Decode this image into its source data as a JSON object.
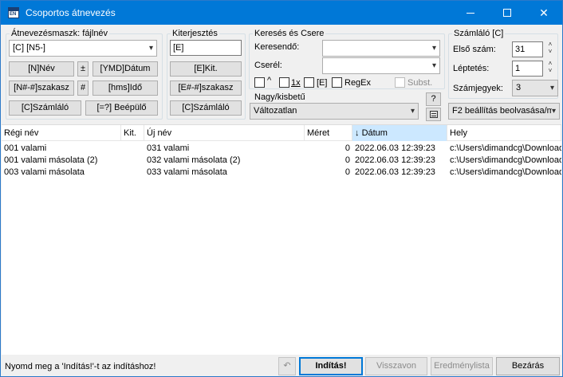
{
  "window": {
    "title": "Csoportos átnevezés",
    "icon_text": "EN"
  },
  "mask": {
    "group_label": "Átnevezésmaszk: fájlnév",
    "value": "[C] [N5-]",
    "buttons": {
      "name": "[N]Név",
      "plusminus": "±",
      "date": "[YMD]Dátum",
      "range": "[N#-#]szakasz",
      "hash": "#",
      "time": "[hms]Idő",
      "counter": "[C]Számláló",
      "plugin": "[=?] Beépülő"
    }
  },
  "extension": {
    "group_label": "Kiterjesztés",
    "value": "[E]",
    "buttons": {
      "ext": "[E]Kit.",
      "range": "[E#-#]szakasz",
      "counter": "[C]Számláló"
    }
  },
  "search_replace": {
    "group_label": "Keresés és Csere",
    "search_label": "Keresendő:",
    "search_value": "",
    "replace_label": "Cserél:",
    "replace_value": "",
    "opt_caret": "^",
    "opt_1x": "1x",
    "opt_e": "[E]",
    "opt_regex": "RegEx",
    "opt_subst": "Subst."
  },
  "case": {
    "group_label": "Nagy/kisbetű",
    "value": "Változatlan",
    "help_label": "?"
  },
  "counter": {
    "group_label": "Számláló [C]",
    "start_label": "Első szám:",
    "start_value": "31",
    "step_label": "Léptetés:",
    "step_value": "1",
    "digits_label": "Számjegyek:",
    "digits_value": "3",
    "f2_label": "F2 beállítás beolvasása/m"
  },
  "list": {
    "columns": {
      "old_name": "Régi név",
      "ext": "Kit.",
      "new_name": "Új név",
      "size": "Méret",
      "date": "Dátum",
      "location": "Hely"
    },
    "sort_arrow": "↓",
    "rows": [
      {
        "old_name": "001 valami",
        "ext": "",
        "new_name": "031 valami",
        "size": "0",
        "date": "2022.06.03 12:39:23",
        "location": "c:\\Users\\dimandcg\\Downloads"
      },
      {
        "old_name": "001 valami másolata (2)",
        "ext": "",
        "new_name": "032 valami másolata (2)",
        "size": "0",
        "date": "2022.06.03 12:39:23",
        "location": "c:\\Users\\dimandcg\\Downloads"
      },
      {
        "old_name": "003 valami másolata",
        "ext": "",
        "new_name": "033 valami másolata",
        "size": "0",
        "date": "2022.06.03 12:39:23",
        "location": "c:\\Users\\dimandcg\\Downloads"
      }
    ]
  },
  "status": {
    "hint": "Nyomd meg a 'Indítás!'-t az indításhoz!",
    "start": "Indítás!",
    "undo": "Visszavon",
    "results": "Eredménylista",
    "close": "Bezárás"
  }
}
